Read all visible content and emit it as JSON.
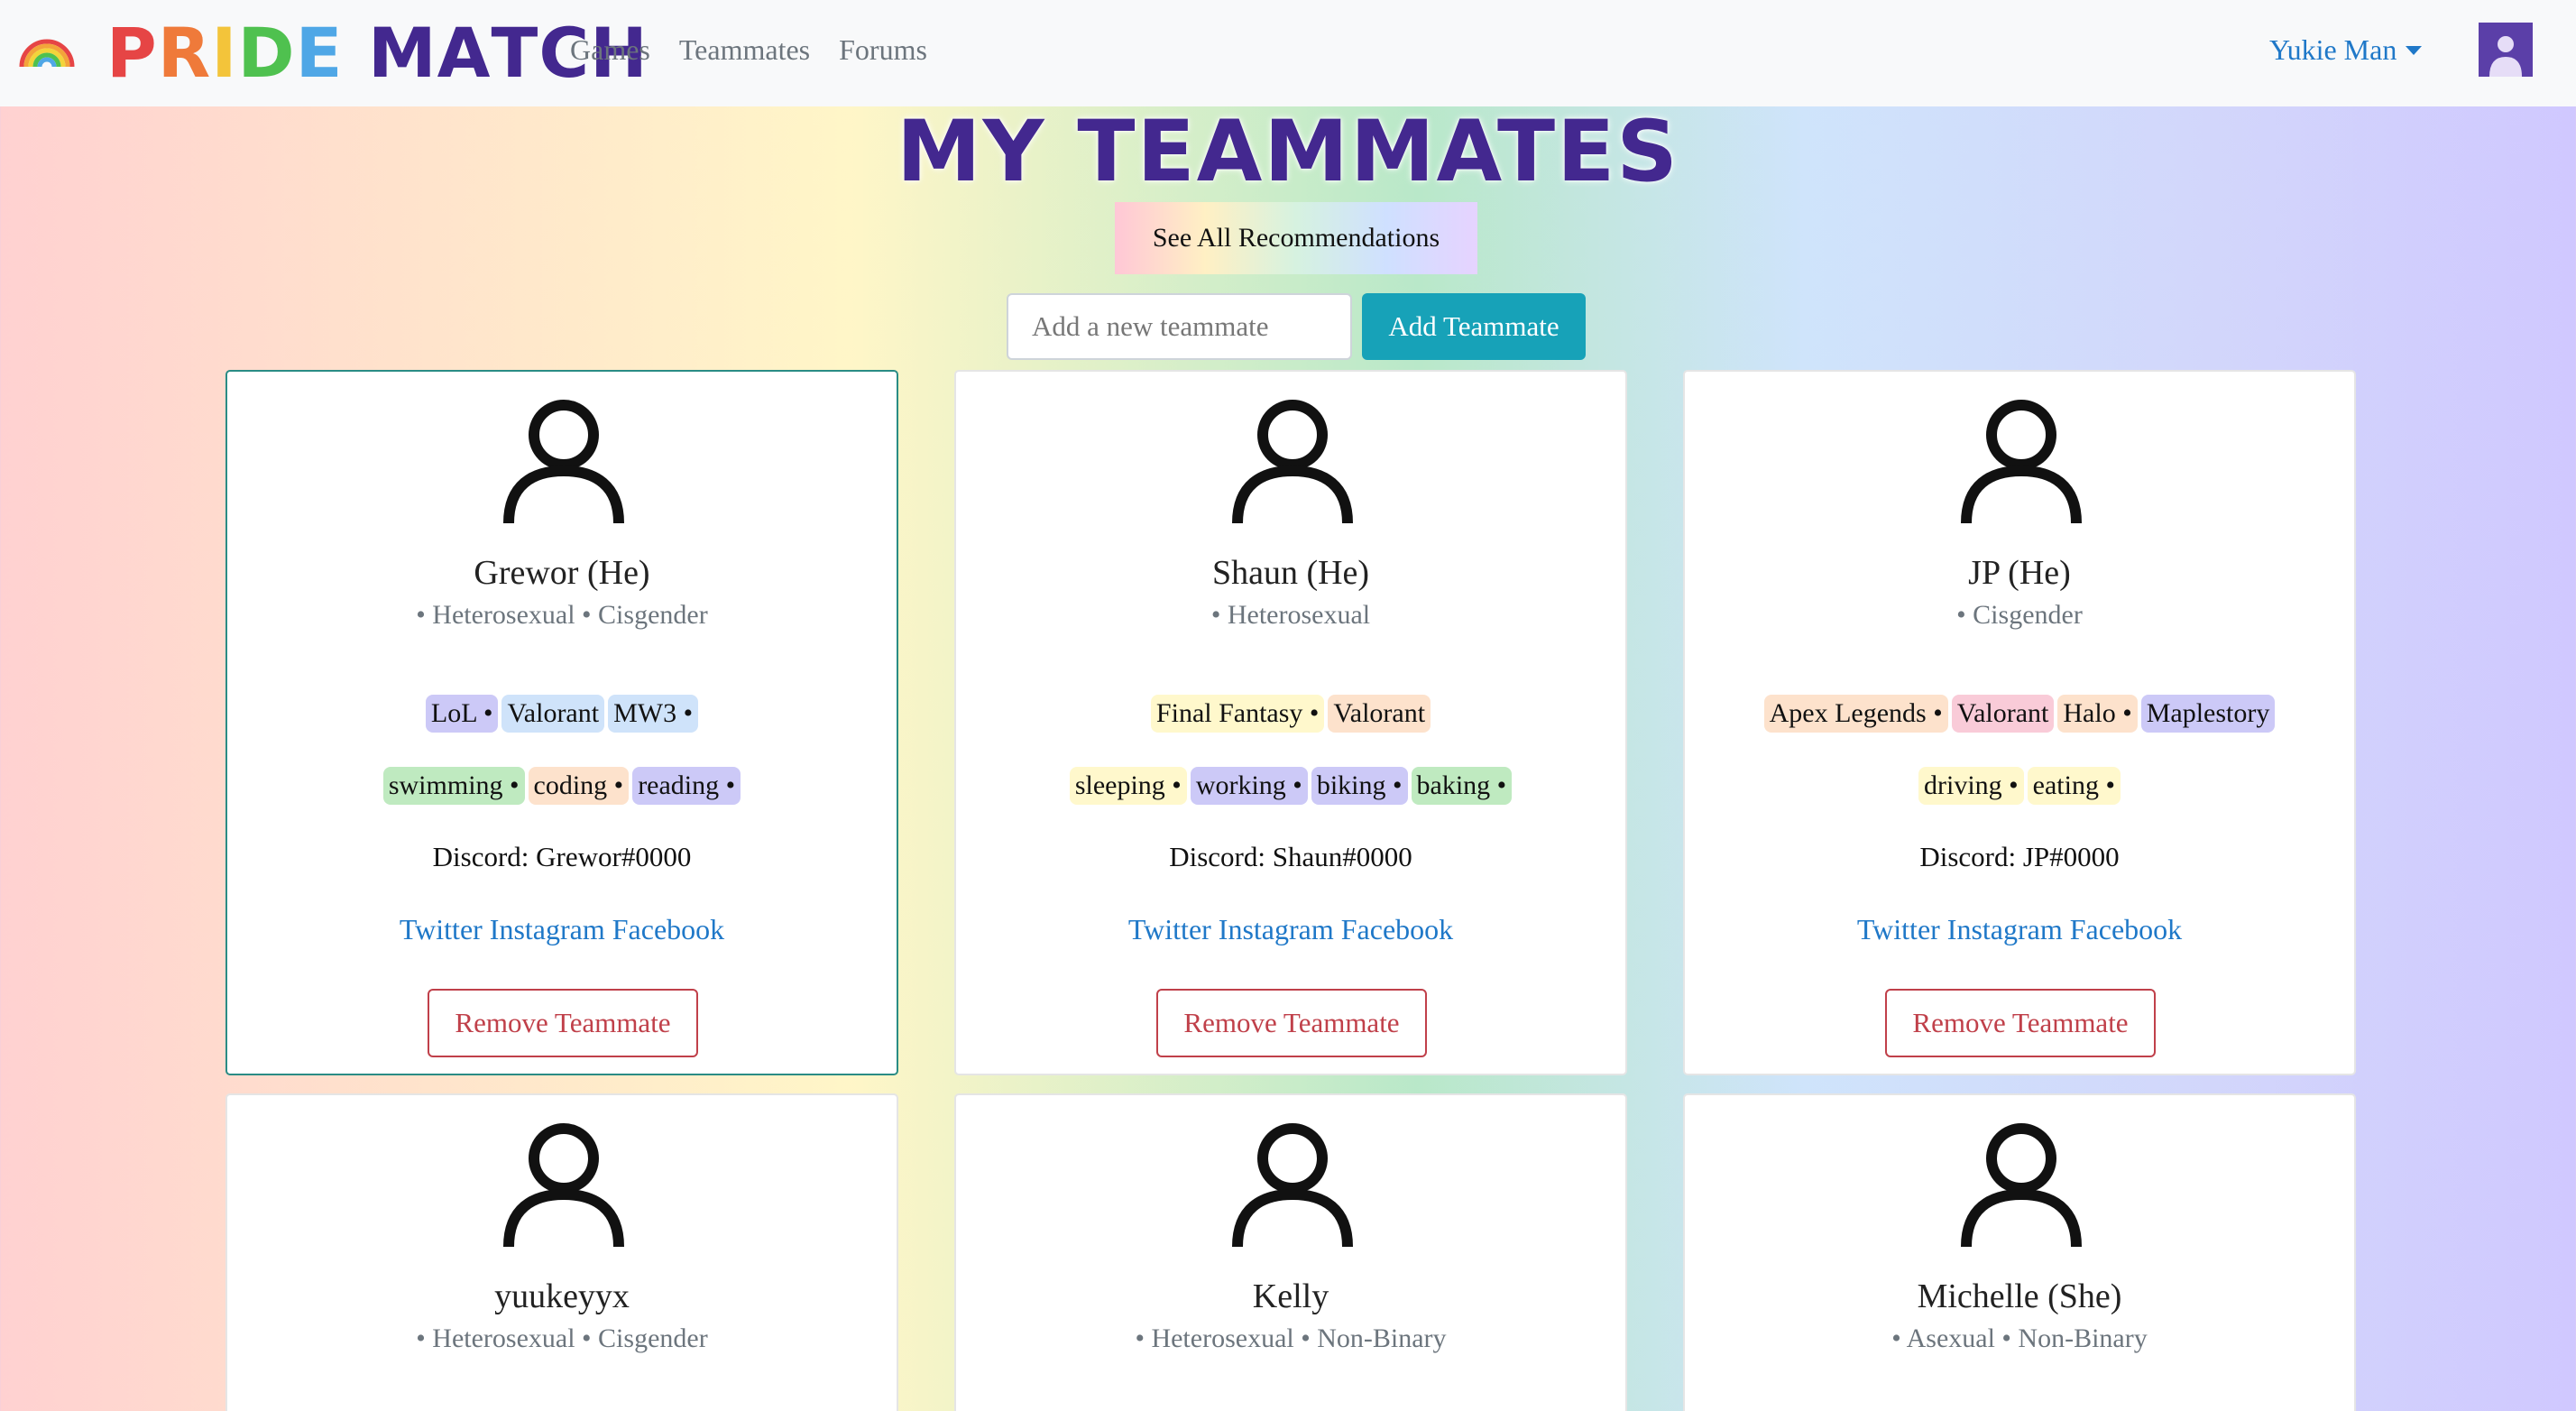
{
  "brand": {
    "letters": [
      {
        "ch": "P",
        "color": "#e64545"
      },
      {
        "ch": "R",
        "color": "#ef7a3a"
      },
      {
        "ch": "I",
        "color": "#f3c43a"
      },
      {
        "ch": "D",
        "color": "#4fc14f"
      },
      {
        "ch": "E",
        "color": "#4fa7e6"
      },
      {
        "ch": " ",
        "color": "#43288f"
      },
      {
        "ch": "M",
        "color": "#43288f"
      },
      {
        "ch": "A",
        "color": "#43288f"
      },
      {
        "ch": "T",
        "color": "#43288f"
      },
      {
        "ch": "C",
        "color": "#43288f"
      },
      {
        "ch": "H",
        "color": "#43288f"
      }
    ],
    "icon": "rainbow-icon"
  },
  "nav": {
    "links": [
      "Games",
      "Teammates",
      "Forums"
    ],
    "user_name": "Yukie Man",
    "avatar_icon": "user-avatar-icon"
  },
  "page": {
    "title": "MY TEAMMATES",
    "see_all_label": "See All Recommendations",
    "add_placeholder": "Add a new teammate",
    "add_button": "Add Teammate"
  },
  "colors": {
    "accent_teal": "#17a2b8",
    "remove_red": "#c0404a",
    "link_blue": "#1f78c8",
    "chip_purple": "#ccc9f7",
    "chip_blue": "#cfe3fa",
    "chip_yellow": "#fff8cc",
    "chip_orange": "#fde2cc",
    "chip_pink": "#f9cbd8",
    "chip_green": "#bfeac0"
  },
  "cards": [
    {
      "name": "Grewor (He)",
      "tags": "• Heterosexual • Cisgender",
      "games": [
        {
          "label": "LoL •",
          "color": "#ccc9f7"
        },
        {
          "label": "Valorant",
          "color": "#cfe3fa"
        },
        {
          "label": "MW3 •",
          "color": "#cfe3fa"
        }
      ],
      "hobbies": [
        {
          "label": "swimming •",
          "color": "#bfeac0"
        },
        {
          "label": "coding •",
          "color": "#fde2cc"
        },
        {
          "label": "reading •",
          "color": "#ccc9f7"
        }
      ],
      "discord": "Discord: Grewor#0000",
      "socials": [
        "Twitter",
        "Instagram",
        "Facebook"
      ],
      "remove_label": "Remove Teammate"
    },
    {
      "name": "Shaun (He)",
      "tags": "• Heterosexual",
      "games": [
        {
          "label": "Final Fantasy •",
          "color": "#fff8cc"
        },
        {
          "label": "Valorant",
          "color": "#fde2cc"
        }
      ],
      "hobbies": [
        {
          "label": "sleeping •",
          "color": "#fff8cc"
        },
        {
          "label": "working •",
          "color": "#ccc9f7"
        },
        {
          "label": "biking •",
          "color": "#ccc9f7"
        },
        {
          "label": "baking •",
          "color": "#bfeac0"
        }
      ],
      "discord": "Discord: Shaun#0000",
      "socials": [
        "Twitter",
        "Instagram",
        "Facebook"
      ],
      "remove_label": "Remove Teammate"
    },
    {
      "name": "JP (He)",
      "tags": "• Cisgender",
      "games": [
        {
          "label": "Apex Legends •",
          "color": "#fde2cc"
        },
        {
          "label": "Valorant",
          "color": "#f9cbd8"
        },
        {
          "label": "Halo •",
          "color": "#fde2cc"
        },
        {
          "label": "Maplestory",
          "color": "#ccc9f7"
        }
      ],
      "hobbies": [
        {
          "label": "driving •",
          "color": "#fff8cc"
        },
        {
          "label": "eating •",
          "color": "#fff8cc"
        }
      ],
      "discord": "Discord: JP#0000",
      "socials": [
        "Twitter",
        "Instagram",
        "Facebook"
      ],
      "remove_label": "Remove Teammate"
    },
    {
      "name": "yuukeyyx",
      "tags": "• Heterosexual • Cisgender"
    },
    {
      "name": "Kelly",
      "tags": "• Heterosexual • Non-Binary"
    },
    {
      "name": "Michelle (She)",
      "tags": "• Asexual • Non-Binary"
    }
  ]
}
